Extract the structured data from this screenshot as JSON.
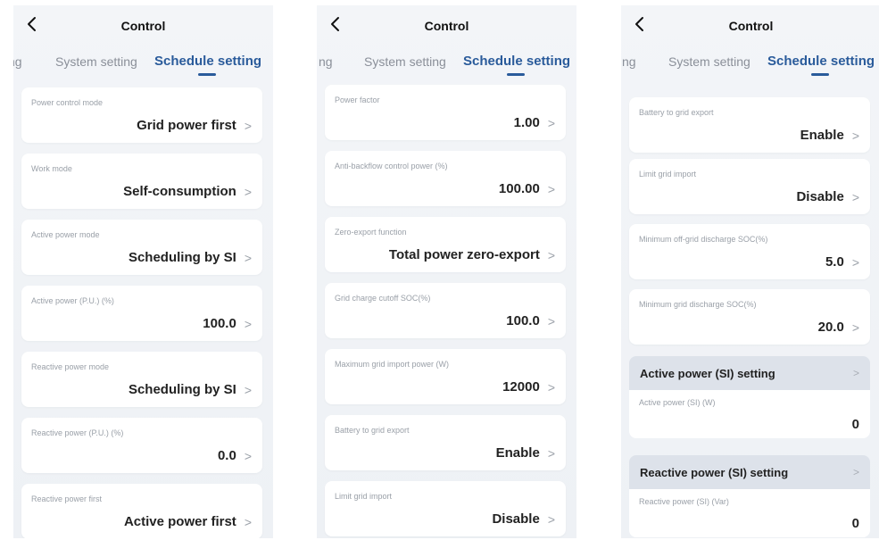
{
  "screens": [
    {
      "title": "Control",
      "tabs": [
        "ng",
        "System setting",
        "Schedule setting"
      ],
      "cards": [
        {
          "label": "Power control mode",
          "value": "Grid power first"
        },
        {
          "label": "Work mode",
          "value": "Self-consumption"
        },
        {
          "label": "Active power mode",
          "value": "Scheduling by SI"
        },
        {
          "label": "Active power (P.U.) (%)",
          "value": "100.0"
        },
        {
          "label": "Reactive power mode",
          "value": "Scheduling by SI"
        },
        {
          "label": "Reactive power (P.U.) (%)",
          "value": "0.0"
        },
        {
          "label": "Reactive power first",
          "value": "Active power first"
        }
      ]
    },
    {
      "title": "Control",
      "tabs": [
        "ng",
        "System setting",
        "Schedule setting"
      ],
      "cards": [
        {
          "label": "Power factor",
          "value": "1.00"
        },
        {
          "label": "Anti-backflow control power (%)",
          "value": "100.00"
        },
        {
          "label": "Zero-export function",
          "value": "Total power zero-export"
        },
        {
          "label": "Grid charge cutoff SOC(%)",
          "value": "100.0"
        },
        {
          "label": "Maximum grid import power (W)",
          "value": "12000"
        },
        {
          "label": "Battery to grid export",
          "value": "Enable"
        },
        {
          "label": "Limit grid import",
          "value": "Disable"
        }
      ]
    },
    {
      "title": "Control",
      "tabs": [
        "ng",
        "System setting",
        "Schedule setting"
      ],
      "cards": [
        {
          "label": "Battery to grid export",
          "value": "Enable"
        },
        {
          "label": "Limit grid import",
          "value": "Disable"
        },
        {
          "label": "Minimum  off-grid discharge SOC(%)",
          "value": "5.0"
        },
        {
          "label": "Minimum grid discharge SOC(%)",
          "value": "20.0"
        }
      ],
      "sections": [
        {
          "title": "Active power (SI) setting",
          "label": "Active power (SI) (W)",
          "value": "0"
        },
        {
          "title": "Reactive power (SI) setting",
          "label": "Reactive power (SI) (Var)",
          "value": "0"
        }
      ]
    }
  ],
  "icons": {
    "back": "chevron-left-icon",
    "row_chevron": "chevron-right-icon"
  },
  "colors": {
    "accent": "#2a5b9b",
    "background": "#f0f3f7",
    "card": "#ffffff",
    "section_header": "#dde2ea"
  }
}
